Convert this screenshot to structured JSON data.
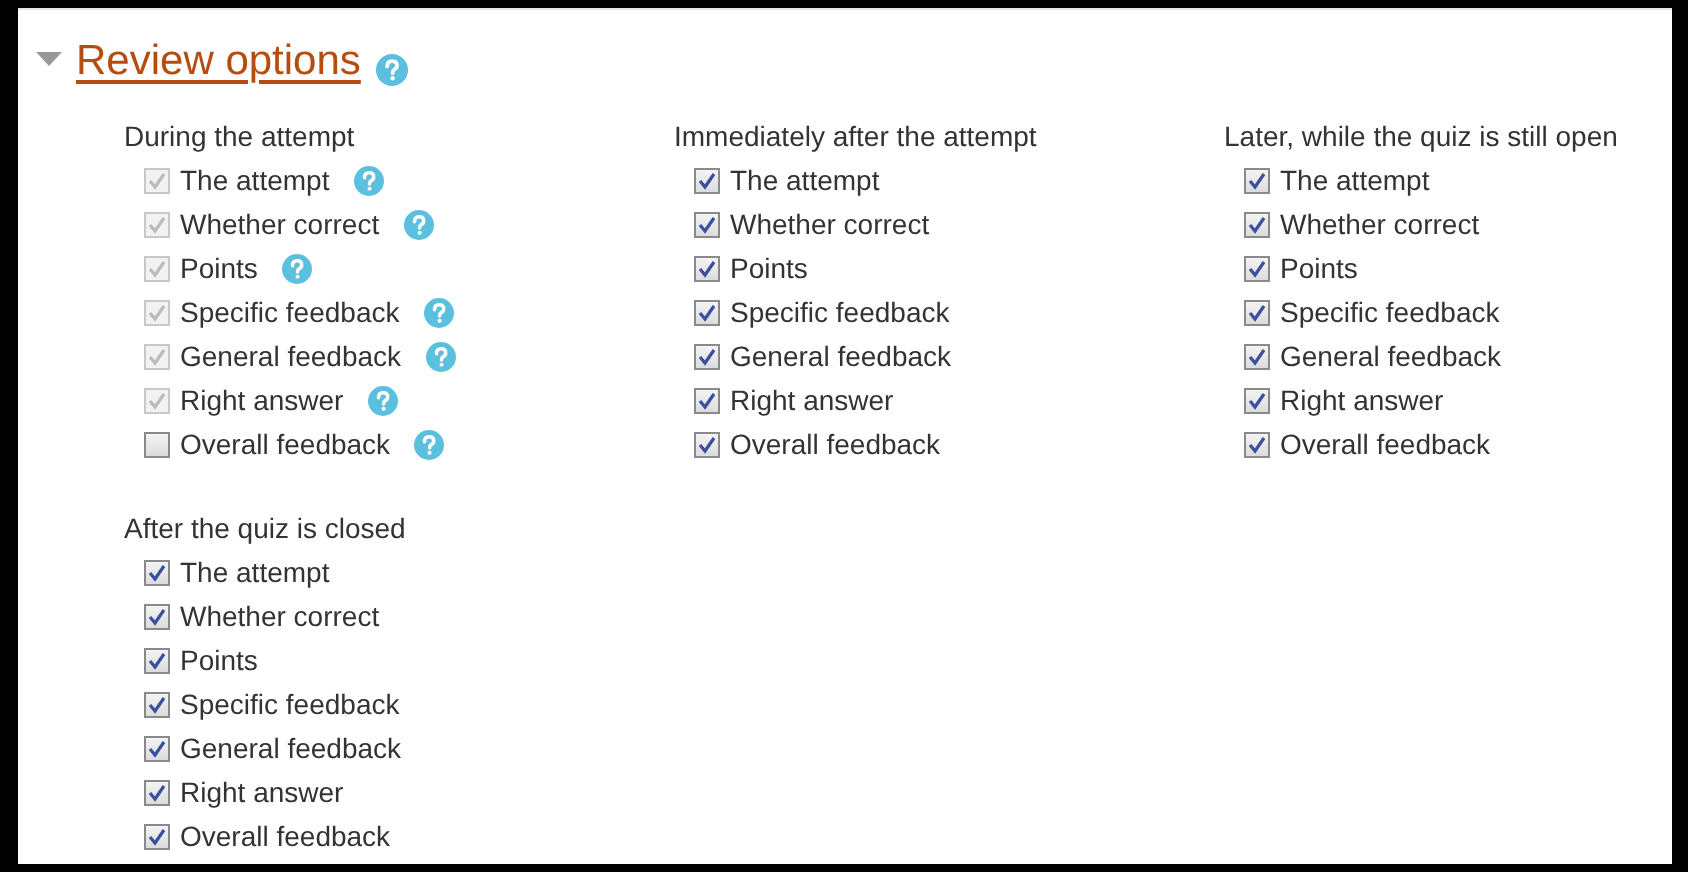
{
  "section": {
    "title": "Review options",
    "expanded": true,
    "help": true
  },
  "groups": [
    {
      "title": "During the attempt",
      "items": [
        {
          "label": "The attempt",
          "checked": true,
          "disabled": true,
          "help": true
        },
        {
          "label": "Whether correct",
          "checked": true,
          "disabled": true,
          "help": true
        },
        {
          "label": "Points",
          "checked": true,
          "disabled": true,
          "help": true
        },
        {
          "label": "Specific feedback",
          "checked": true,
          "disabled": true,
          "help": true
        },
        {
          "label": "General feedback",
          "checked": true,
          "disabled": true,
          "help": true
        },
        {
          "label": "Right answer",
          "checked": true,
          "disabled": true,
          "help": true
        },
        {
          "label": "Overall feedback",
          "checked": false,
          "disabled": false,
          "help": true
        }
      ]
    },
    {
      "title": "Immediately after the attempt",
      "items": [
        {
          "label": "The attempt",
          "checked": true,
          "disabled": false,
          "help": false
        },
        {
          "label": "Whether correct",
          "checked": true,
          "disabled": false,
          "help": false
        },
        {
          "label": "Points",
          "checked": true,
          "disabled": false,
          "help": false
        },
        {
          "label": "Specific feedback",
          "checked": true,
          "disabled": false,
          "help": false
        },
        {
          "label": "General feedback",
          "checked": true,
          "disabled": false,
          "help": false
        },
        {
          "label": "Right answer",
          "checked": true,
          "disabled": false,
          "help": false
        },
        {
          "label": "Overall feedback",
          "checked": true,
          "disabled": false,
          "help": false
        }
      ]
    },
    {
      "title": "Later, while the quiz is still open",
      "items": [
        {
          "label": "The attempt",
          "checked": true,
          "disabled": false,
          "help": false
        },
        {
          "label": "Whether correct",
          "checked": true,
          "disabled": false,
          "help": false
        },
        {
          "label": "Points",
          "checked": true,
          "disabled": false,
          "help": false
        },
        {
          "label": "Specific feedback",
          "checked": true,
          "disabled": false,
          "help": false
        },
        {
          "label": "General feedback",
          "checked": true,
          "disabled": false,
          "help": false
        },
        {
          "label": "Right answer",
          "checked": true,
          "disabled": false,
          "help": false
        },
        {
          "label": "Overall feedback",
          "checked": true,
          "disabled": false,
          "help": false
        }
      ]
    },
    {
      "title": "After the quiz is closed",
      "items": [
        {
          "label": "The attempt",
          "checked": true,
          "disabled": false,
          "help": false
        },
        {
          "label": "Whether correct",
          "checked": true,
          "disabled": false,
          "help": false
        },
        {
          "label": "Points",
          "checked": true,
          "disabled": false,
          "help": false
        },
        {
          "label": "Specific feedback",
          "checked": true,
          "disabled": false,
          "help": false
        },
        {
          "label": "General feedback",
          "checked": true,
          "disabled": false,
          "help": false
        },
        {
          "label": "Right answer",
          "checked": true,
          "disabled": false,
          "help": false
        },
        {
          "label": "Overall feedback",
          "checked": true,
          "disabled": false,
          "help": false
        }
      ]
    }
  ]
}
